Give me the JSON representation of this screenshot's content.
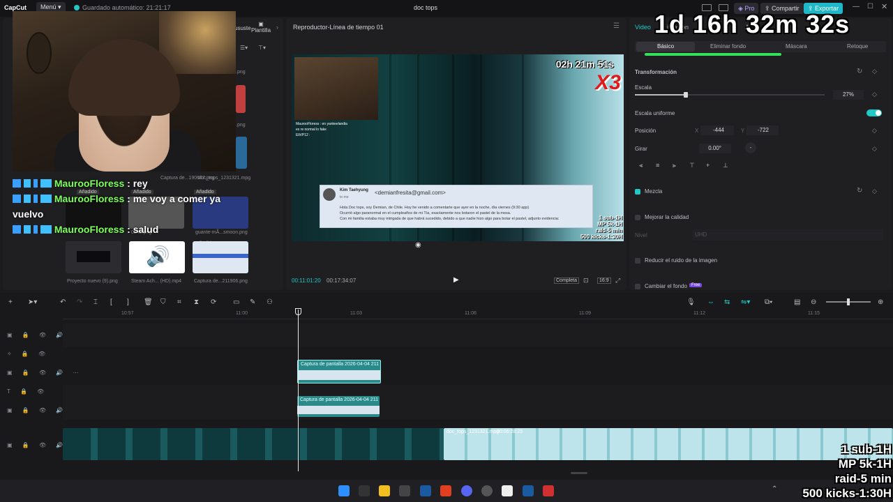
{
  "app": {
    "logo": "CapCut",
    "menu_label": "Menú",
    "autosave": "Guardado automático: 21:21:17",
    "project_title": "doc tops",
    "pro_label": "Pro",
    "share_label": "Compartir",
    "export_label": "Exportar"
  },
  "overlay": {
    "big_timer": "1d 16h 32m 32s",
    "side_goals": "1 sub-1H\nMP 5k-1H\nraid-5 min\n500 kicks-1:30H",
    "chat": [
      {
        "user": "MaurooFloress",
        "text": ": rey"
      },
      {
        "user": "MaurooFloress",
        "text": ": me voy a comer ya vuelvo"
      },
      {
        "user": "MaurooFloress",
        "text": ": salud"
      }
    ]
  },
  "media": {
    "tabs": [
      "ususte",
      "Plantilla"
    ],
    "thumbs": [
      {
        "label": "Proyecto nuevo (9).png",
        "badge": ""
      },
      {
        "label": "Steam Ach... (HD).mp4",
        "badge": ""
      },
      {
        "label": "Captura de...211906.png",
        "badge": "Añadido"
      }
    ],
    "row_labels": [
      "Captura de...190647.png",
      "doc_tops_1231321.mpg"
    ],
    "added_badge": "Añadido",
    "misc_labels": [
      ".png",
      ".png",
      "0245.png",
      "guante-mÃ...smoon.png"
    ]
  },
  "player": {
    "title": "Reproductor-Línea de tiempo 01",
    "current_time": "00:11:01:20",
    "total_time": "00:17:34:07",
    "complete_label": "Completa",
    "ratio_label": "16:9",
    "video": {
      "timer": "02h 21m 51s",
      "multiplier": "X3",
      "side": "1 sub-1H\nMP 5k-1H\nraid-5 min\n500 kicks-1:30H",
      "mini_chat": [
        "MaurooFloress : en yankeelandia",
        "es re normal lo fake",
        "EliVP12 :"
      ],
      "email": {
        "from": "Kim Taehyung",
        "address": "<demianfresita@gmail.com>",
        "to": "to me",
        "lines": [
          "Hola Doc tops, soy Demian, de Chile. Hoy he venido a comentarte que ayer en la noche, día viernes (9:30 app)",
          "Ocurrió algo paranormal en el cumpleaños de mi Tía, exactamente nos botaron el pastel de la mesa.",
          "Con mi familia estaba muy intrigada de que habrá sucedido, debido a que nadie hizo algo para botar el pastel, adjunto evidencia:"
        ]
      }
    }
  },
  "props": {
    "top_tab": "Video",
    "top_tab_2": "imación",
    "top_tab_3": "Aj",
    "subtabs": [
      "Básico",
      "Eliminar fondo",
      "Máscara",
      "Retoque"
    ],
    "transform_label": "Transformación",
    "scale_label": "Escala",
    "scale_value": "27%",
    "scale_fraction": 0.27,
    "uniform_label": "Escala uniforme",
    "position_label": "Posición",
    "pos_x_label": "X",
    "pos_x": "-444",
    "pos_y_label": "Y",
    "pos_y": "-722",
    "rotate_label": "Girar",
    "rotate_value": "0.00°",
    "rotate_dash": "-",
    "blend_label": "Mezcla",
    "enhance_label": "Mejorar la calidad",
    "level_label": "Nivel",
    "level_value": "UHD",
    "denoise_label": "Reducir el ruido de la imagen",
    "bg_label": "Cambiar el fondo",
    "free_badge": "Free"
  },
  "timeline": {
    "ruler": [
      "10:57",
      "11:00",
      "11:03",
      "11:06",
      "11:09",
      "11:12",
      "11:15"
    ],
    "clip1": "Captura de pantalla 2026-04-04 211",
    "clip2": "Captura de pantalla 2026-04-04 211",
    "main_clip_name": "doc_tops_1231321.mpg",
    "main_clip_duration": "00:06:28:23"
  },
  "colors": {
    "accent": "#20c8c8",
    "export": "#1fb8c8",
    "chat_user": "#7dff5a",
    "clip": "#1e6e6e"
  }
}
